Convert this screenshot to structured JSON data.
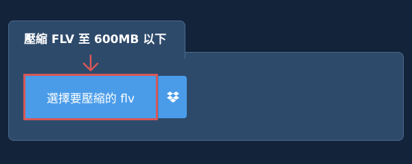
{
  "tab": {
    "title": "壓縮 FLV 至 600MB 以下"
  },
  "upload": {
    "select_label": "選擇要壓縮的 flv",
    "dropbox_icon": "dropbox-icon",
    "arrow_icon": "arrow-down-icon"
  },
  "colors": {
    "background": "#13233a",
    "panel": "#2e4a6b",
    "button": "#4a9ce9",
    "highlight": "#d95757"
  }
}
